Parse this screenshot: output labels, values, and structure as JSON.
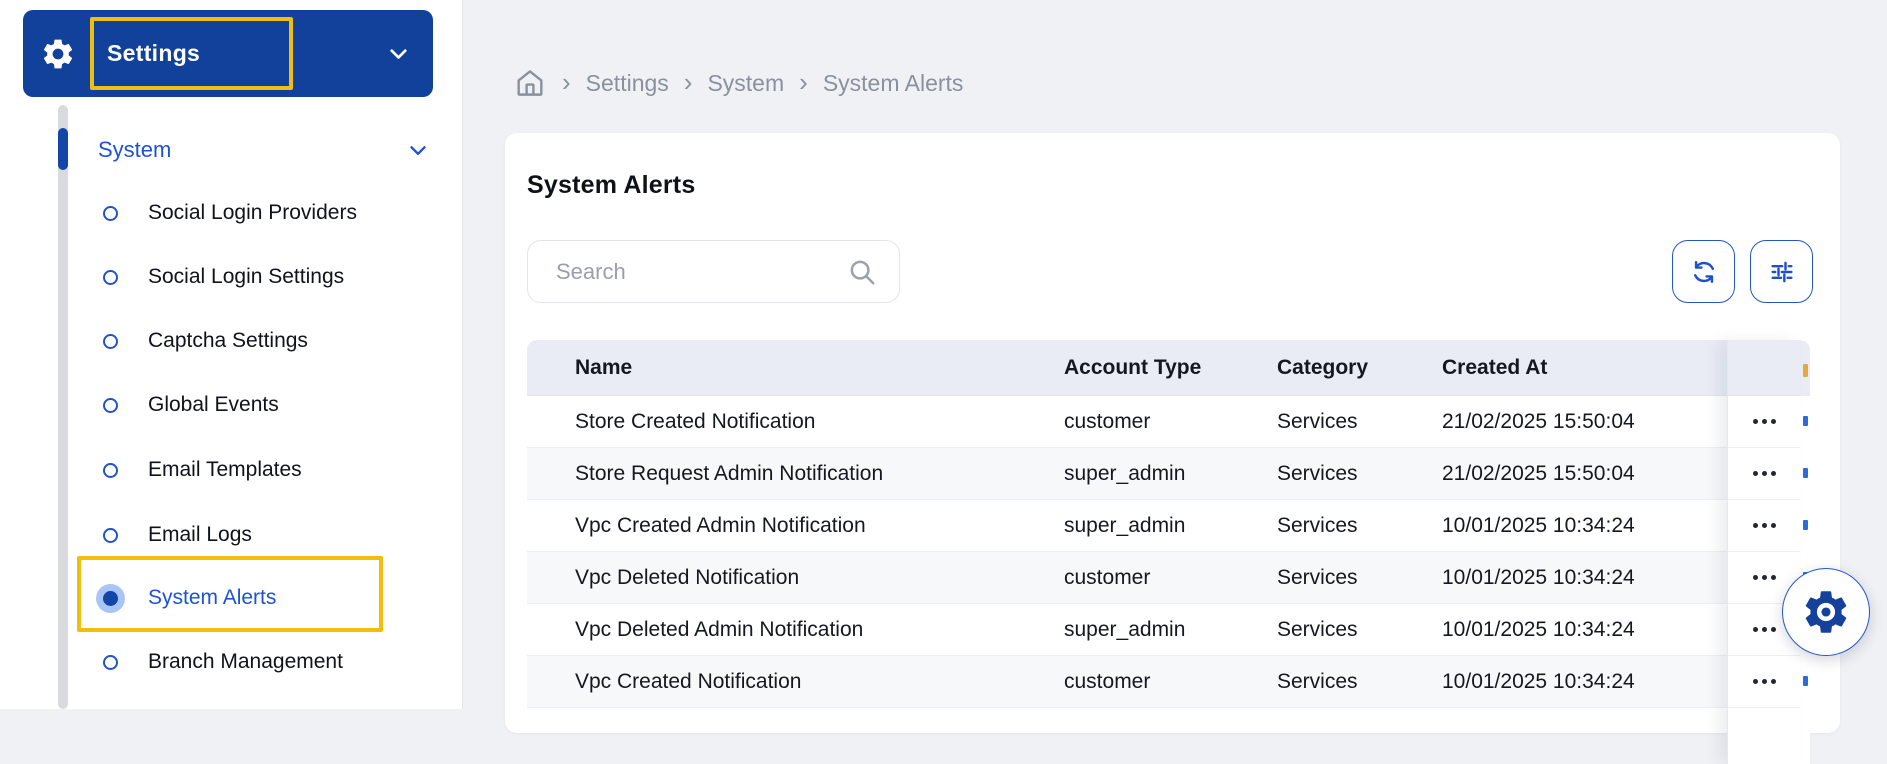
{
  "colors": {
    "sidebar_header_bg": "#12419C",
    "accent_blue": "#1D52D7",
    "active_marker_blue": "#1445A8",
    "annotation_yellow": "#F0BE0C",
    "table_header_bg": "#E9ECF5",
    "page_bg": "#F0F1F5"
  },
  "icons": {
    "sidebar_header": "gear-icon",
    "sidebar_header_right": "chevron-down-icon",
    "group_right": "chevron-down-icon",
    "breadcrumb_home": "home-icon",
    "search": "magnifier-icon",
    "toolbar": [
      "refresh-icon",
      "sliders-icon"
    ],
    "row_actions": "ellipsis-icon",
    "floating_button": "gear-icon"
  },
  "sidebar": {
    "header": {
      "label": "Settings"
    },
    "group": {
      "label": "System"
    },
    "items": [
      {
        "label": "Social Login Providers",
        "selected": false
      },
      {
        "label": "Social Login Settings",
        "selected": false
      },
      {
        "label": "Captcha Settings",
        "selected": false
      },
      {
        "label": "Global Events",
        "selected": false
      },
      {
        "label": "Email Templates",
        "selected": false
      },
      {
        "label": "Email Logs",
        "selected": false
      },
      {
        "label": "System Alerts",
        "selected": true
      },
      {
        "label": "Branch Management",
        "selected": false
      }
    ]
  },
  "breadcrumb": {
    "items": [
      "Settings",
      "System",
      "System Alerts"
    ],
    "separator": "›"
  },
  "main": {
    "title": "System Alerts",
    "search": {
      "placeholder": "Search",
      "value": ""
    },
    "table": {
      "columns": [
        "Name",
        "Account Type",
        "Category",
        "Created At"
      ],
      "rows": [
        {
          "name": "Store Created Notification",
          "account_type": "customer",
          "category": "Services",
          "created_at": "21/02/2025 15:50:04"
        },
        {
          "name": "Store Request Admin Notification",
          "account_type": "super_admin",
          "category": "Services",
          "created_at": "21/02/2025 15:50:04"
        },
        {
          "name": "Vpc Created Admin Notification",
          "account_type": "super_admin",
          "category": "Services",
          "created_at": "10/01/2025 10:34:24"
        },
        {
          "name": "Vpc Deleted Notification",
          "account_type": "customer",
          "category": "Services",
          "created_at": "10/01/2025 10:34:24"
        },
        {
          "name": "Vpc Deleted Admin Notification",
          "account_type": "super_admin",
          "category": "Services",
          "created_at": "10/01/2025 10:34:24"
        },
        {
          "name": "Vpc Created Notification",
          "account_type": "customer",
          "category": "Services",
          "created_at": "10/01/2025 10:34:24"
        }
      ]
    }
  }
}
